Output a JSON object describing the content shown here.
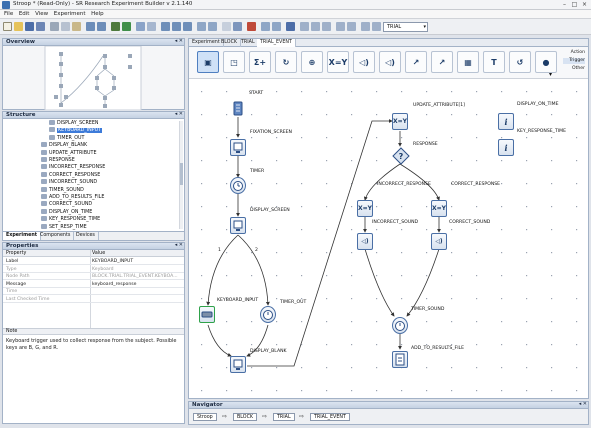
{
  "app": {
    "title": "Stroop * (Read-Only) - SR Research Experiment Builder v 2.1.140",
    "win_min": "–",
    "win_max": "□",
    "win_close": "×"
  },
  "menu": [
    "File",
    "Edit",
    "View",
    "Experiment",
    "Help"
  ],
  "toolbar": {
    "combo_value": "TRIAL",
    "combo_arrow": "▾"
  },
  "overview": {
    "title": "Overview",
    "controls": "◂ ✕"
  },
  "structure": {
    "title": "Structure",
    "controls": "◂ ✕",
    "items": [
      {
        "label": "DISPLAY_SCREEN",
        "level": 2,
        "selected": false
      },
      {
        "label": "KEYBOARD_INPUT",
        "level": 2,
        "selected": true
      },
      {
        "label": "TIMER_OUT",
        "level": 2,
        "selected": false
      },
      {
        "label": "DISPLAY_BLANK",
        "level": 1,
        "selected": false
      },
      {
        "label": "UPDATE_ATTRIBUTE",
        "level": 1,
        "selected": false
      },
      {
        "label": "RESPONSE",
        "level": 1,
        "selected": false
      },
      {
        "label": "INCORRECT_RESPONSE",
        "level": 1,
        "selected": false
      },
      {
        "label": "CORRECT_RESPONSE",
        "level": 1,
        "selected": false
      },
      {
        "label": "INCORRECT_SOUND",
        "level": 1,
        "selected": false
      },
      {
        "label": "TIMER_SOUND",
        "level": 1,
        "selected": false
      },
      {
        "label": "ADD_TO_RESULTS_FILE",
        "level": 1,
        "selected": false
      },
      {
        "label": "CORRECT_SOUND",
        "level": 1,
        "selected": false
      },
      {
        "label": "DISPLAY_ON_TIME",
        "level": 1,
        "selected": false
      },
      {
        "label": "KEY_RESPONSE_TIME",
        "level": 1,
        "selected": false
      },
      {
        "label": "SET_RESP_TIME",
        "level": 1,
        "selected": false
      }
    ],
    "tabs": [
      "Experiment",
      "Components",
      "Devices"
    ]
  },
  "properties": {
    "title": "Properties",
    "controls": "◂ ✕",
    "col_property": "Property",
    "col_value": "Value",
    "rows": [
      {
        "key": "Label",
        "value": "KEYBOARD_INPUT",
        "dim": false
      },
      {
        "key": "Type",
        "value": "Keyboard",
        "dim": true
      },
      {
        "key": "Node Path",
        "value": "BLOCK.TRIAL.TRIAL_EVENT.KEYBOA...",
        "dim": true
      },
      {
        "key": "Message",
        "value": "keyboard_response",
        "dim": false
      },
      {
        "key": "Time",
        "value": "",
        "dim": true
      },
      {
        "key": "Last Checked Time",
        "value": "",
        "dim": true
      }
    ],
    "note_title": "Note",
    "note_text": "Keyboard trigger used to collect response from the subject. Possible keys are B, G, and R."
  },
  "editor": {
    "tabs": [
      "Experiment",
      "BLOCK",
      "TRIAL",
      "TRIAL_EVENT"
    ],
    "active_tab": 3,
    "side_labels": [
      "Action",
      "Trigger",
      "Other"
    ],
    "palette": [
      "▣",
      "◳",
      "Σ+",
      "↻",
      "⊕",
      "X=Y",
      "◁)",
      "◁)",
      "↗",
      "↗",
      "▦",
      "T",
      "↺",
      "●",
      "▾"
    ],
    "nodes": {
      "start": "START",
      "fixation": "FIXATION_SCREEN",
      "timer": "TIMER",
      "display": "DISPLAY_SCREEN",
      "keyboard": "KEYBOARD_INPUT",
      "timer_out": "TIMER_OUT",
      "display_blank": "DISPLAY_BLANK",
      "update_attr": "UPDATE_ATTRIBUTE[1]",
      "response": "RESPONSE",
      "incorrect_resp": "INCORRECT_RESPONSE",
      "correct_resp": "CORRECT_RESPONSE",
      "incorrect_sound": "INCORRECT_SOUND",
      "correct_sound": "CORRECT_SOUND",
      "timer_sound": "TIMER_SOUND",
      "add_results": "ADD_TO_RESULTS_FILE",
      "display_on_time": "DISPLAY_ON_TIME",
      "key_resp_time": "KEY_RESPONSE_TIME",
      "branch1": "1",
      "branch2": "2"
    }
  },
  "navigator": {
    "title": "Navigator",
    "controls": "◂ ✕",
    "crumbs": [
      "Stroop",
      "BLOCK",
      "TRIAL",
      "TRIAL_EVENT"
    ],
    "arrow": "⇨"
  },
  "colors": {
    "accent": "#3d7bd9",
    "node_border": "#4a6fa5",
    "panel_header": "#c4d1e3"
  }
}
